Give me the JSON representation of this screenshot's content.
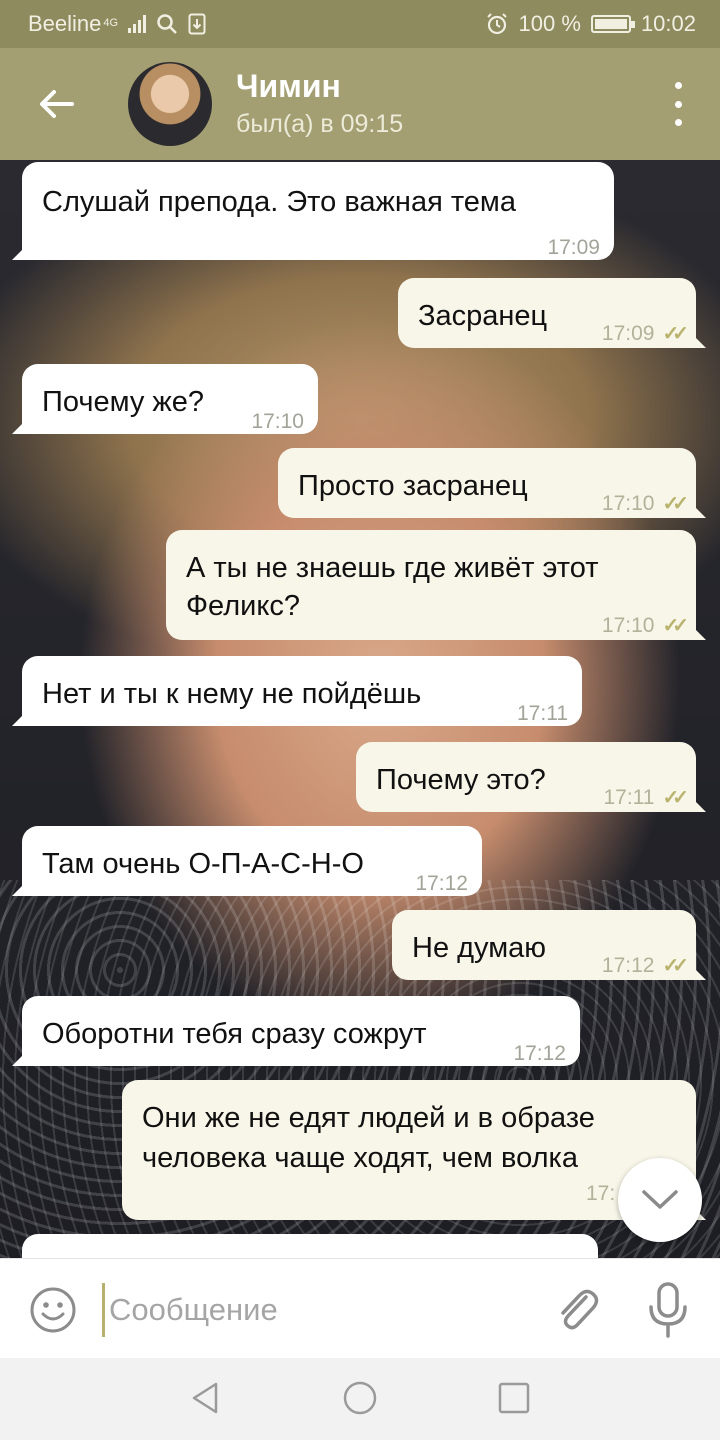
{
  "status_bar": {
    "carrier": "Beeline",
    "network": "4G",
    "battery_percent": "100 %",
    "battery_level": 1.0,
    "time": "10:02",
    "icons": [
      "signal-icon",
      "search-icon",
      "download-icon",
      "alarm-icon",
      "battery-charging-icon"
    ]
  },
  "header": {
    "contact_name": "Чимин",
    "last_seen": "был(а) в 09:15",
    "icons": [
      "back-arrow-icon",
      "avatar",
      "more-vert-icon"
    ]
  },
  "messages": [
    {
      "direction": "in",
      "text": "Слушай препода. Это важная тема",
      "time": "17:09"
    },
    {
      "direction": "out",
      "text": "Засранец",
      "time": "17:09",
      "read": true
    },
    {
      "direction": "in",
      "text": "Почему же?",
      "time": "17:10"
    },
    {
      "direction": "out",
      "text": "Просто засранец",
      "time": "17:10",
      "read": true
    },
    {
      "direction": "out",
      "text": "А ты не знаешь где живёт этот",
      "text2": "Феликс?",
      "time": "17:10",
      "read": true
    },
    {
      "direction": "in",
      "text": "Нет и ты  к нему не пойдёшь",
      "time": "17:11"
    },
    {
      "direction": "out",
      "text": "Почему это?",
      "time": "17:11",
      "read": true
    },
    {
      "direction": "in",
      "text": "Там очень О-П-А-С-Н-О",
      "time": "17:12"
    },
    {
      "direction": "out",
      "text": "Не думаю",
      "time": "17:12",
      "read": true
    },
    {
      "direction": "in",
      "text": "Оборотни тебя сразу сожрут",
      "time": "17:12"
    },
    {
      "direction": "out",
      "text": "Они же не едят людей и в образе",
      "text2": "человека чаще ходят, чем волка",
      "time": "17:"
    }
  ],
  "input": {
    "placeholder": "Сообщение",
    "value": "",
    "icons": [
      "emoji-icon",
      "paperclip-icon",
      "mic-icon"
    ]
  },
  "colors": {
    "header_bg": "#a39f72",
    "status_bg": "#8e8b5f",
    "incoming_bubble": "#ffffff",
    "outgoing_bubble": "#f8f6e8",
    "read_ticks": "#b9b36e"
  }
}
